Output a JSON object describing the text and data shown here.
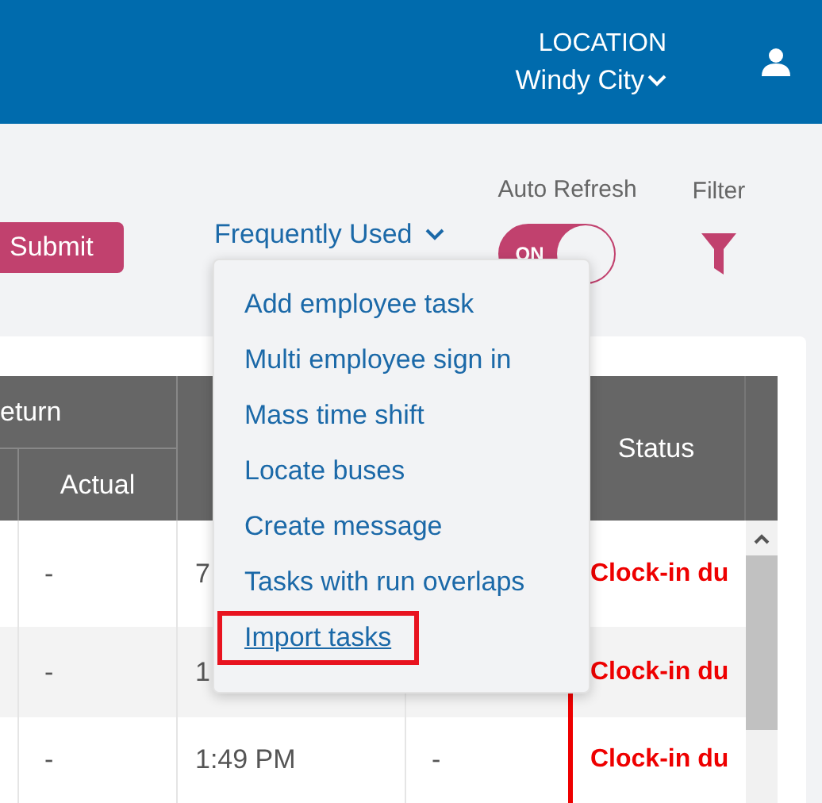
{
  "header": {
    "location_label": "LOCATION",
    "location": "Windy City"
  },
  "toolbar": {
    "submit": "Submit",
    "auto_refresh": {
      "label": "Auto Refresh",
      "on": true,
      "state_text": "ON"
    },
    "filter": {
      "label": "Filter"
    }
  },
  "menu": {
    "label": "Frequently Used",
    "expanded": true,
    "items": [
      {
        "label": "Add employee task",
        "highlighted": false
      },
      {
        "label": "Multi employee sign in",
        "highlighted": false
      },
      {
        "label": "Mass time shift",
        "highlighted": false
      },
      {
        "label": "Locate buses",
        "highlighted": false
      },
      {
        "label": "Create message",
        "highlighted": false
      },
      {
        "label": "Tasks with run overlaps",
        "highlighted": false
      },
      {
        "label": "Import tasks",
        "highlighted": true
      }
    ]
  },
  "table": {
    "group_header": "eturn",
    "sub_header": "Actual",
    "status_header": "Status",
    "rows": [
      {
        "column_1": "-",
        "column_2": "7",
        "status": "Clock-in du"
      },
      {
        "column_1": "-",
        "column_2": "1",
        "status": "Clock-in du"
      },
      {
        "column_1": "-",
        "column_2": "1:49 PM",
        "column_3": "-",
        "status": "Clock-in du"
      }
    ]
  }
}
